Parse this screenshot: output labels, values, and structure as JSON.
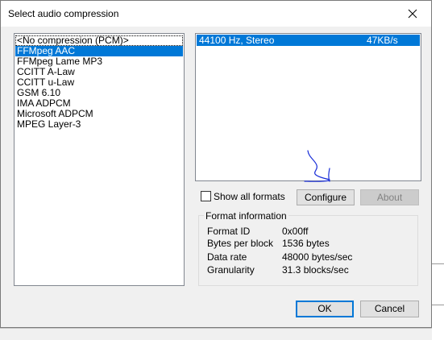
{
  "window": {
    "title": "Select audio compression"
  },
  "codecs": {
    "items": [
      "<No compression (PCM)>",
      "FFMpeg AAC",
      "FFMpeg Lame MP3",
      "CCITT A-Law",
      "CCITT u-Law",
      "GSM 6.10",
      "IMA ADPCM",
      "Microsoft ADPCM",
      "MPEG Layer-3"
    ],
    "selected_index": 1
  },
  "formats": {
    "items": [
      {
        "rate": "44100 Hz, Stereo",
        "bitrate": "47KB/s"
      }
    ],
    "selected_index": 0
  },
  "options": {
    "show_all_formats_label": "Show all formats",
    "show_all_formats_checked": false
  },
  "buttons": {
    "configure": "Configure",
    "about": "About",
    "ok": "OK",
    "cancel": "Cancel"
  },
  "format_info": {
    "title": "Format information",
    "rows": [
      {
        "label": "Format ID",
        "value": "0x00ff"
      },
      {
        "label": "Bytes per block",
        "value": "1536 bytes"
      },
      {
        "label": "Data rate",
        "value": "48000 bytes/sec"
      },
      {
        "label": "Granularity",
        "value": "31.3 blocks/sec"
      }
    ]
  },
  "colors": {
    "selection": "#0078d7",
    "annotation_ink": "#1a2fd8"
  }
}
